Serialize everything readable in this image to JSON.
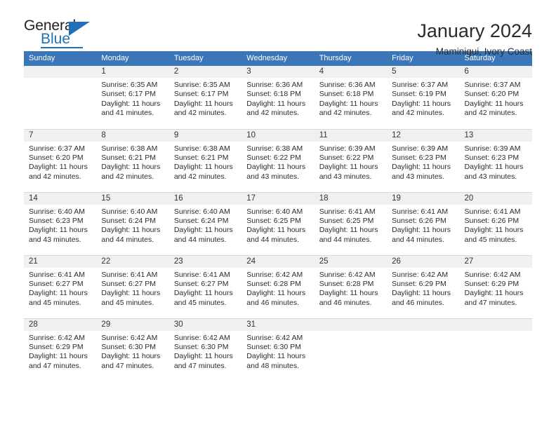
{
  "logo": {
    "text_primary": "General",
    "text_secondary": "Blue",
    "triangle_icon": "triangle-icon",
    "brand_color": "#1e70b8"
  },
  "header": {
    "title": "January 2024",
    "subtitle": "Maminigui, Ivory Coast"
  },
  "calendar": {
    "header_background": "#3b76b8",
    "daynum_background": "#f0f0f0",
    "weekday_headers": [
      "Sunday",
      "Monday",
      "Tuesday",
      "Wednesday",
      "Thursday",
      "Friday",
      "Saturday"
    ],
    "weeks": [
      [
        {
          "day": "",
          "empty": true,
          "sunrise": "",
          "sunset": "",
          "daylight_line1": "",
          "daylight_line2": ""
        },
        {
          "day": "1",
          "sunrise": "Sunrise: 6:35 AM",
          "sunset": "Sunset: 6:17 PM",
          "daylight_line1": "Daylight: 11 hours",
          "daylight_line2": "and 41 minutes."
        },
        {
          "day": "2",
          "sunrise": "Sunrise: 6:35 AM",
          "sunset": "Sunset: 6:17 PM",
          "daylight_line1": "Daylight: 11 hours",
          "daylight_line2": "and 42 minutes."
        },
        {
          "day": "3",
          "sunrise": "Sunrise: 6:36 AM",
          "sunset": "Sunset: 6:18 PM",
          "daylight_line1": "Daylight: 11 hours",
          "daylight_line2": "and 42 minutes."
        },
        {
          "day": "4",
          "sunrise": "Sunrise: 6:36 AM",
          "sunset": "Sunset: 6:18 PM",
          "daylight_line1": "Daylight: 11 hours",
          "daylight_line2": "and 42 minutes."
        },
        {
          "day": "5",
          "sunrise": "Sunrise: 6:37 AM",
          "sunset": "Sunset: 6:19 PM",
          "daylight_line1": "Daylight: 11 hours",
          "daylight_line2": "and 42 minutes."
        },
        {
          "day": "6",
          "sunrise": "Sunrise: 6:37 AM",
          "sunset": "Sunset: 6:20 PM",
          "daylight_line1": "Daylight: 11 hours",
          "daylight_line2": "and 42 minutes."
        }
      ],
      [
        {
          "day": "7",
          "sunrise": "Sunrise: 6:37 AM",
          "sunset": "Sunset: 6:20 PM",
          "daylight_line1": "Daylight: 11 hours",
          "daylight_line2": "and 42 minutes."
        },
        {
          "day": "8",
          "sunrise": "Sunrise: 6:38 AM",
          "sunset": "Sunset: 6:21 PM",
          "daylight_line1": "Daylight: 11 hours",
          "daylight_line2": "and 42 minutes."
        },
        {
          "day": "9",
          "sunrise": "Sunrise: 6:38 AM",
          "sunset": "Sunset: 6:21 PM",
          "daylight_line1": "Daylight: 11 hours",
          "daylight_line2": "and 42 minutes."
        },
        {
          "day": "10",
          "sunrise": "Sunrise: 6:38 AM",
          "sunset": "Sunset: 6:22 PM",
          "daylight_line1": "Daylight: 11 hours",
          "daylight_line2": "and 43 minutes."
        },
        {
          "day": "11",
          "sunrise": "Sunrise: 6:39 AM",
          "sunset": "Sunset: 6:22 PM",
          "daylight_line1": "Daylight: 11 hours",
          "daylight_line2": "and 43 minutes."
        },
        {
          "day": "12",
          "sunrise": "Sunrise: 6:39 AM",
          "sunset": "Sunset: 6:23 PM",
          "daylight_line1": "Daylight: 11 hours",
          "daylight_line2": "and 43 minutes."
        },
        {
          "day": "13",
          "sunrise": "Sunrise: 6:39 AM",
          "sunset": "Sunset: 6:23 PM",
          "daylight_line1": "Daylight: 11 hours",
          "daylight_line2": "and 43 minutes."
        }
      ],
      [
        {
          "day": "14",
          "sunrise": "Sunrise: 6:40 AM",
          "sunset": "Sunset: 6:23 PM",
          "daylight_line1": "Daylight: 11 hours",
          "daylight_line2": "and 43 minutes."
        },
        {
          "day": "15",
          "sunrise": "Sunrise: 6:40 AM",
          "sunset": "Sunset: 6:24 PM",
          "daylight_line1": "Daylight: 11 hours",
          "daylight_line2": "and 44 minutes."
        },
        {
          "day": "16",
          "sunrise": "Sunrise: 6:40 AM",
          "sunset": "Sunset: 6:24 PM",
          "daylight_line1": "Daylight: 11 hours",
          "daylight_line2": "and 44 minutes."
        },
        {
          "day": "17",
          "sunrise": "Sunrise: 6:40 AM",
          "sunset": "Sunset: 6:25 PM",
          "daylight_line1": "Daylight: 11 hours",
          "daylight_line2": "and 44 minutes."
        },
        {
          "day": "18",
          "sunrise": "Sunrise: 6:41 AM",
          "sunset": "Sunset: 6:25 PM",
          "daylight_line1": "Daylight: 11 hours",
          "daylight_line2": "and 44 minutes."
        },
        {
          "day": "19",
          "sunrise": "Sunrise: 6:41 AM",
          "sunset": "Sunset: 6:26 PM",
          "daylight_line1": "Daylight: 11 hours",
          "daylight_line2": "and 44 minutes."
        },
        {
          "day": "20",
          "sunrise": "Sunrise: 6:41 AM",
          "sunset": "Sunset: 6:26 PM",
          "daylight_line1": "Daylight: 11 hours",
          "daylight_line2": "and 45 minutes."
        }
      ],
      [
        {
          "day": "21",
          "sunrise": "Sunrise: 6:41 AM",
          "sunset": "Sunset: 6:27 PM",
          "daylight_line1": "Daylight: 11 hours",
          "daylight_line2": "and 45 minutes."
        },
        {
          "day": "22",
          "sunrise": "Sunrise: 6:41 AM",
          "sunset": "Sunset: 6:27 PM",
          "daylight_line1": "Daylight: 11 hours",
          "daylight_line2": "and 45 minutes."
        },
        {
          "day": "23",
          "sunrise": "Sunrise: 6:41 AM",
          "sunset": "Sunset: 6:27 PM",
          "daylight_line1": "Daylight: 11 hours",
          "daylight_line2": "and 45 minutes."
        },
        {
          "day": "24",
          "sunrise": "Sunrise: 6:42 AM",
          "sunset": "Sunset: 6:28 PM",
          "daylight_line1": "Daylight: 11 hours",
          "daylight_line2": "and 46 minutes."
        },
        {
          "day": "25",
          "sunrise": "Sunrise: 6:42 AM",
          "sunset": "Sunset: 6:28 PM",
          "daylight_line1": "Daylight: 11 hours",
          "daylight_line2": "and 46 minutes."
        },
        {
          "day": "26",
          "sunrise": "Sunrise: 6:42 AM",
          "sunset": "Sunset: 6:29 PM",
          "daylight_line1": "Daylight: 11 hours",
          "daylight_line2": "and 46 minutes."
        },
        {
          "day": "27",
          "sunrise": "Sunrise: 6:42 AM",
          "sunset": "Sunset: 6:29 PM",
          "daylight_line1": "Daylight: 11 hours",
          "daylight_line2": "and 47 minutes."
        }
      ],
      [
        {
          "day": "28",
          "sunrise": "Sunrise: 6:42 AM",
          "sunset": "Sunset: 6:29 PM",
          "daylight_line1": "Daylight: 11 hours",
          "daylight_line2": "and 47 minutes."
        },
        {
          "day": "29",
          "sunrise": "Sunrise: 6:42 AM",
          "sunset": "Sunset: 6:30 PM",
          "daylight_line1": "Daylight: 11 hours",
          "daylight_line2": "and 47 minutes."
        },
        {
          "day": "30",
          "sunrise": "Sunrise: 6:42 AM",
          "sunset": "Sunset: 6:30 PM",
          "daylight_line1": "Daylight: 11 hours",
          "daylight_line2": "and 47 minutes."
        },
        {
          "day": "31",
          "sunrise": "Sunrise: 6:42 AM",
          "sunset": "Sunset: 6:30 PM",
          "daylight_line1": "Daylight: 11 hours",
          "daylight_line2": "and 48 minutes."
        },
        {
          "day": "",
          "empty": true,
          "sunrise": "",
          "sunset": "",
          "daylight_line1": "",
          "daylight_line2": ""
        },
        {
          "day": "",
          "empty": true,
          "sunrise": "",
          "sunset": "",
          "daylight_line1": "",
          "daylight_line2": ""
        },
        {
          "day": "",
          "empty": true,
          "sunrise": "",
          "sunset": "",
          "daylight_line1": "",
          "daylight_line2": ""
        }
      ]
    ]
  }
}
